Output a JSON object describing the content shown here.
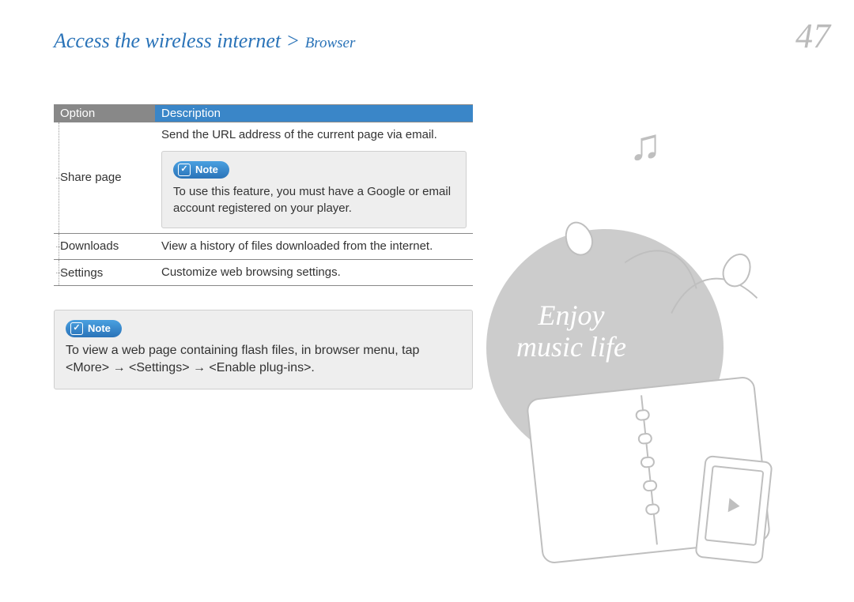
{
  "header": {
    "breadcrumb_main": "Access the wireless internet > ",
    "breadcrumb_sub": "Browser",
    "page_number": "47"
  },
  "table": {
    "headers": {
      "option": "Option",
      "description": "Description"
    },
    "rows": [
      {
        "option": "Share page",
        "description_pre": "Send the URL address of the current page via email.",
        "note_label": "Note",
        "note_body": "To use this feature, you must have a Google or email account registered on your player."
      },
      {
        "option": "Downloads",
        "description": "View a history of files downloaded from the internet."
      },
      {
        "option": "Settings",
        "description": "Customize web browsing settings."
      }
    ]
  },
  "footer_note": {
    "label": "Note",
    "body": "To view a web page containing flash files, in browser menu, tap <More> → <Settings> → <Enable plug-ins>."
  },
  "illustration": {
    "caption_line1": "Enjoy",
    "caption_line2": "music life"
  }
}
